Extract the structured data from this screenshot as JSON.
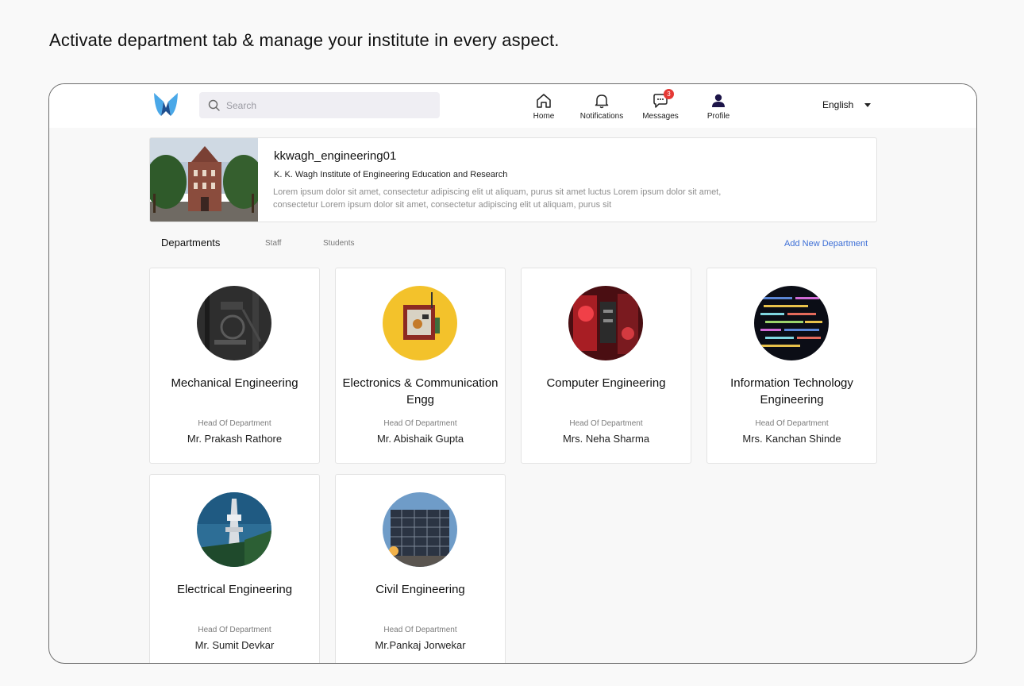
{
  "headline": "Activate department tab & manage your institute in every aspect.",
  "nav": {
    "search_placeholder": "Search",
    "home_label": "Home",
    "notifications_label": "Notifications",
    "messages_label": "Messages",
    "messages_badge": "3",
    "profile_label": "Profile",
    "language": "English"
  },
  "institute": {
    "username": "kkwagh_engineering01",
    "name": "K. K. Wagh Institute of Engineering Education and Research",
    "description": "Lorem ipsum dolor sit amet, consectetur adipiscing elit ut aliquam, purus sit amet luctus Lorem ipsum dolor sit amet, consectetur Lorem ipsum dolor sit amet, consectetur adipiscing elit ut aliquam, purus sit"
  },
  "tabs": {
    "departments": "Departments",
    "staff": "Staff",
    "students": "Students",
    "add_department": "Add New Department"
  },
  "departments": [
    {
      "name": "Mechanical Engineering",
      "hod_label": "Head Of Department",
      "hod": "Mr. Prakash Rathore",
      "icon": "mechanical-photo"
    },
    {
      "name": "Electronics & Communication Engg",
      "hod_label": "Head Of Department",
      "hod": "Mr. Abishaik Gupta",
      "icon": "electronics-photo"
    },
    {
      "name": "Computer Engineering",
      "hod_label": "Head Of Department",
      "hod": "Mrs. Neha Sharma",
      "icon": "computer-photo"
    },
    {
      "name": "Information Technology Engineering",
      "hod_label": "Head Of Department",
      "hod": "Mrs. Kanchan  Shinde",
      "icon": "it-photo"
    },
    {
      "name": "Electrical Engineering",
      "hod_label": "Head Of Department",
      "hod": "Mr. Sumit Devkar",
      "icon": "electrical-photo"
    },
    {
      "name": "Civil Engineering",
      "hod_label": "Head Of Department",
      "hod": "Mr.Pankaj Jorwekar",
      "icon": "civil-photo"
    }
  ],
  "colors": {
    "link": "#3d6fd6",
    "badge": "#e53935",
    "logo_light": "#4aa8e8",
    "logo_dark": "#1f4f8f"
  }
}
